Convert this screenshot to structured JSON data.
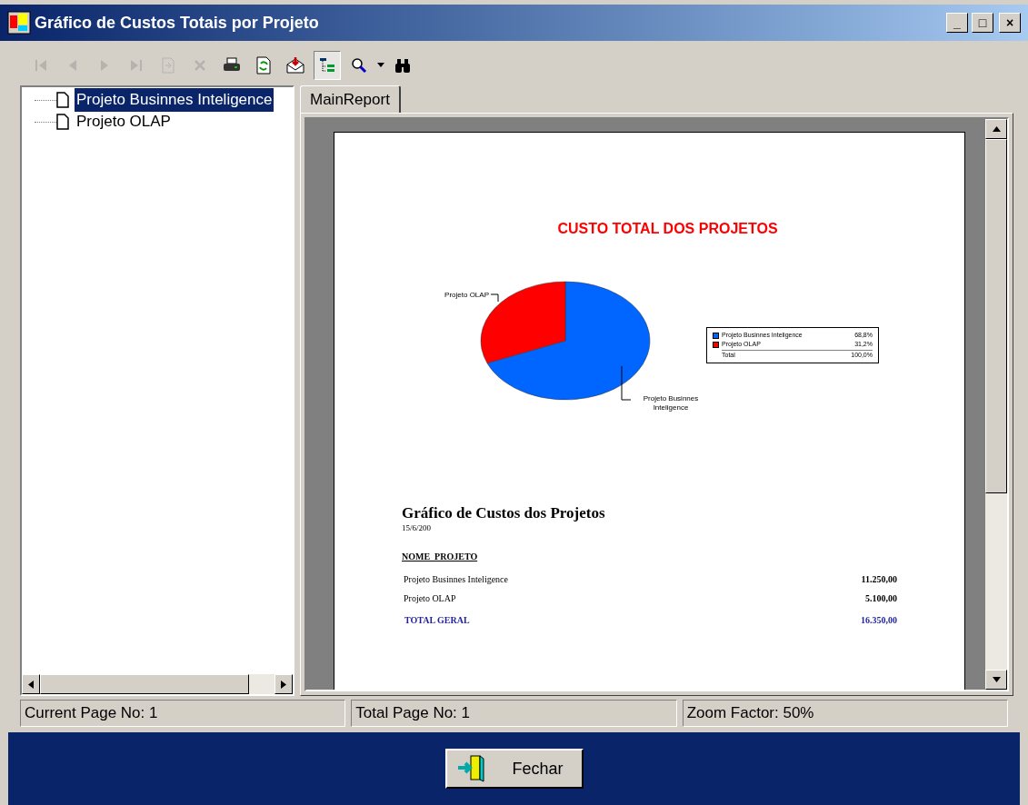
{
  "window": {
    "title": "Gráfico de Custos Totais por Projeto",
    "controls": [
      "_",
      "□",
      "×"
    ]
  },
  "toolbar": [
    {
      "kind": "first",
      "disabled": true,
      "pressed": false
    },
    {
      "kind": "prev",
      "disabled": true,
      "pressed": false
    },
    {
      "kind": "next",
      "disabled": true,
      "pressed": false
    },
    {
      "kind": "last",
      "disabled": true,
      "pressed": false
    },
    {
      "kind": "goto",
      "disabled": true,
      "pressed": false
    },
    {
      "kind": "close",
      "disabled": true,
      "pressed": false
    },
    {
      "kind": "print",
      "disabled": false,
      "pressed": false
    },
    {
      "kind": "refresh",
      "disabled": false,
      "pressed": false
    },
    {
      "kind": "export",
      "disabled": false,
      "pressed": false
    },
    {
      "kind": "tree",
      "disabled": false,
      "pressed": true
    },
    {
      "kind": "zoom",
      "disabled": false,
      "pressed": false
    },
    {
      "kind": "search",
      "disabled": false,
      "pressed": false
    }
  ],
  "tree": {
    "items": [
      {
        "label": "Projeto Businnes Inteligence",
        "selected": true
      },
      {
        "label": "Projeto OLAP",
        "selected": false
      }
    ]
  },
  "tabs": [
    {
      "label": "MainReport",
      "selected": true
    }
  ],
  "report": {
    "chart_title": "CUSTO TOTAL DOS PROJETOS",
    "chart_data": {
      "type": "pie",
      "categories": [
        "Projeto Businnes Inteligence",
        "Projeto OLAP"
      ],
      "series": [
        {
          "values": [
            68.8,
            31.2
          ]
        }
      ]
    },
    "legend": [
      {
        "label": "Projeto Businnes Inteligence",
        "value": "68,8%",
        "color": "#0066ff"
      },
      {
        "label": "Projeto OLAP",
        "value": "31,2%",
        "color": "#ff0000"
      }
    ],
    "legend_total": {
      "label": "Total",
      "value": "100,0%"
    },
    "title": "Gráfico de Custos dos Projetos",
    "date": "15/6/200",
    "column": "NOME_PROJETO",
    "rows": [
      {
        "name": "Projeto Businnes Inteligence",
        "value": "11.250,00"
      },
      {
        "name": "Projeto OLAP",
        "value": "5.100,00"
      }
    ],
    "total": {
      "label": "TOTAL GERAL",
      "value": "16.350,00"
    }
  },
  "status_bar": [
    "Current Page No: 1",
    "Total Page No: 1",
    "Zoom Factor: 50%"
  ],
  "close_button": {
    "label": "Fechar"
  }
}
